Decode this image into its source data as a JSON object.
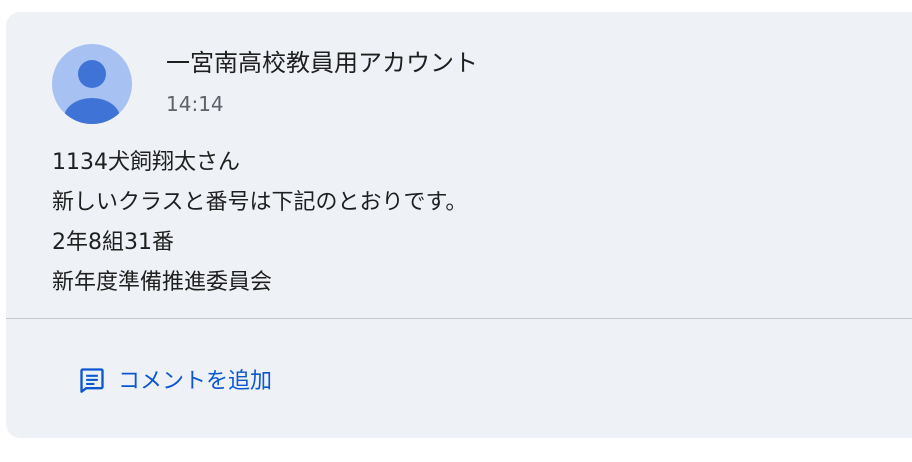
{
  "post": {
    "author": "一宮南高校教員用アカウント",
    "time": "14:14",
    "body": [
      "1134犬飼翔太さん",
      "新しいクラスと番号は下記のとおりです。",
      "2年8組31番",
      "新年度準備推進委員会"
    ]
  },
  "actions": {
    "add_comment_label": "コメントを追加"
  },
  "icons": {
    "avatar": "person-avatar-icon",
    "comment": "comment-icon"
  },
  "colors": {
    "card_background": "#eef1f6",
    "avatar_background": "#a7c1f3",
    "avatar_figure": "#3f74d6",
    "accent": "#0b57d0"
  }
}
